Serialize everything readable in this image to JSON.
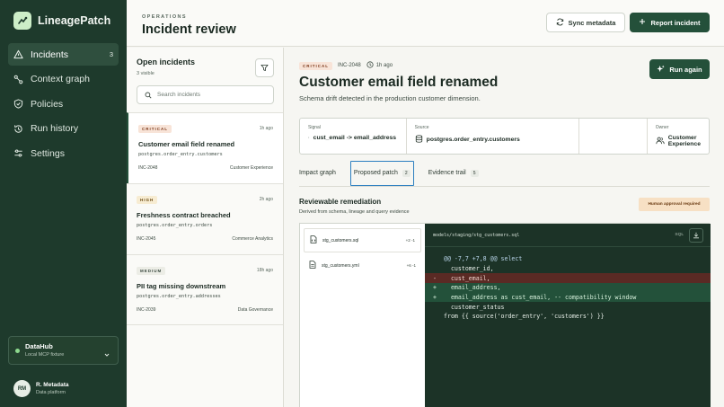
{
  "app": {
    "name": "LineagePatch"
  },
  "sidebar": {
    "items": [
      {
        "label": "Incidents",
        "count": "3",
        "icon": "warning-triangle-icon"
      },
      {
        "label": "Context graph",
        "icon": "graph-icon"
      },
      {
        "label": "Policies",
        "icon": "shield-icon"
      },
      {
        "label": "Run history",
        "icon": "history-icon"
      },
      {
        "label": "Settings",
        "icon": "sliders-icon"
      }
    ],
    "workspace": {
      "name": "DataHub",
      "sub": "Local MCP fixture"
    },
    "user": {
      "initials": "RM",
      "name": "R. Metadata",
      "role": "Data platform"
    }
  },
  "header": {
    "eyebrow": "OPERATIONS",
    "title": "Incident review",
    "sync_label": "Sync metadata",
    "report_label": "Report incident"
  },
  "incidents": {
    "title": "Open incidents",
    "visible": "3 visible",
    "search_placeholder": "Search incidents",
    "items": [
      {
        "severity": "CRITICAL",
        "time": "1h ago",
        "title": "Customer email field renamed",
        "asset": "postgres.order_entry.customers",
        "id": "INC-2048",
        "owner": "Customer Experience"
      },
      {
        "severity": "HIGH",
        "time": "2h ago",
        "title": "Freshness contract breached",
        "asset": "postgres.order_entry.orders",
        "id": "INC-2045",
        "owner": "Commerce Analytics"
      },
      {
        "severity": "MEDIUM",
        "time": "18h ago",
        "title": "PII tag missing downstream",
        "asset": "postgres.order_entry.addresses",
        "id": "INC-2039",
        "owner": "Data Governance"
      }
    ]
  },
  "detail": {
    "severity": "CRITICAL",
    "id": "INC-2048",
    "time": "1h ago",
    "title": "Customer email field renamed",
    "subtitle": "Schema drift detected in the production customer dimension.",
    "run_again_label": "Run again",
    "signal": {
      "label": "Signal",
      "value": "cust_email -> email_address"
    },
    "source": {
      "label": "Source",
      "value": "postgres.order_entry.customers"
    },
    "owner": {
      "label": "Owner",
      "value": "Customer Experience"
    },
    "tabs": [
      {
        "label": "Impact graph",
        "badge": ""
      },
      {
        "label": "Proposed patch",
        "badge": "2"
      },
      {
        "label": "Evidence trail",
        "badge": "5"
      }
    ],
    "remediation": {
      "title": "Reviewable remediation",
      "subtitle": "Derived from schema, lineage and query evidence",
      "approval": "Human approval required"
    },
    "files": [
      {
        "name": "stg_customers.sql",
        "diff": "+2 -1"
      },
      {
        "name": "stg_customers.yml",
        "diff": "+6 -1"
      }
    ],
    "code": {
      "path": "models/staging/stg_customers.sql",
      "lang": "SQL",
      "lines": [
        {
          "kind": "hunk",
          "mark": "",
          "text": "@@ -7,7 +7,8 @@ select"
        },
        {
          "kind": "ctx",
          "mark": "",
          "text": "  customer_id,"
        },
        {
          "kind": "del",
          "mark": "-",
          "text": "  cust_email,"
        },
        {
          "kind": "add",
          "mark": "+",
          "text": "  email_address,"
        },
        {
          "kind": "add",
          "mark": "+",
          "text": "  email_address as cust_email, -- compatibility window"
        },
        {
          "kind": "ctx",
          "mark": "",
          "text": "  customer_status"
        },
        {
          "kind": "ctx",
          "mark": "",
          "text": "from {{ source('order_entry', 'customers') }}"
        }
      ]
    }
  },
  "colors": {
    "sidebar": "#1e3a2c",
    "primary": "#24503a",
    "critical_bg": "#f8e4d8",
    "approval_bg": "#f7e0c4"
  }
}
